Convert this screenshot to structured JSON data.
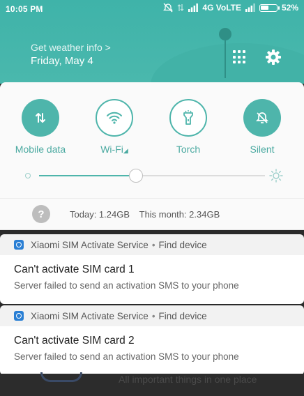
{
  "status": {
    "time": "10:05 PM",
    "network": "4G VoLTE",
    "battery": "52%",
    "battery_level": 0.52
  },
  "header": {
    "weather_link": "Get weather info >",
    "date": "Friday, May 4"
  },
  "toggles": [
    {
      "label": "Mobile data",
      "icon": "mobile-data-icon",
      "state": "on"
    },
    {
      "label": "Wi-Fi",
      "icon": "wifi-icon",
      "state": "off"
    },
    {
      "label": "Torch",
      "icon": "torch-icon",
      "state": "off"
    },
    {
      "label": "Silent",
      "icon": "silent-icon",
      "state": "on"
    }
  ],
  "brightness": {
    "level": 0.43
  },
  "data_usage": {
    "today": "Today: 1.24GB",
    "month": "This month: 2.34GB"
  },
  "notifications": [
    {
      "app": "Xiaomi SIM Activate Service",
      "action": "Find device",
      "title": "Can't activate SIM card 1",
      "text": "Server failed to send an activation SMS to your phone"
    },
    {
      "app": "Xiaomi SIM Activate Service",
      "action": "Find device",
      "title": "Can't activate SIM card 2",
      "text": "Server failed to send an activation SMS to your phone"
    }
  ],
  "background_app": {
    "text": "All important things in one place"
  },
  "colors": {
    "accent": "#4eb5ab",
    "header": "#3fb3a9"
  }
}
